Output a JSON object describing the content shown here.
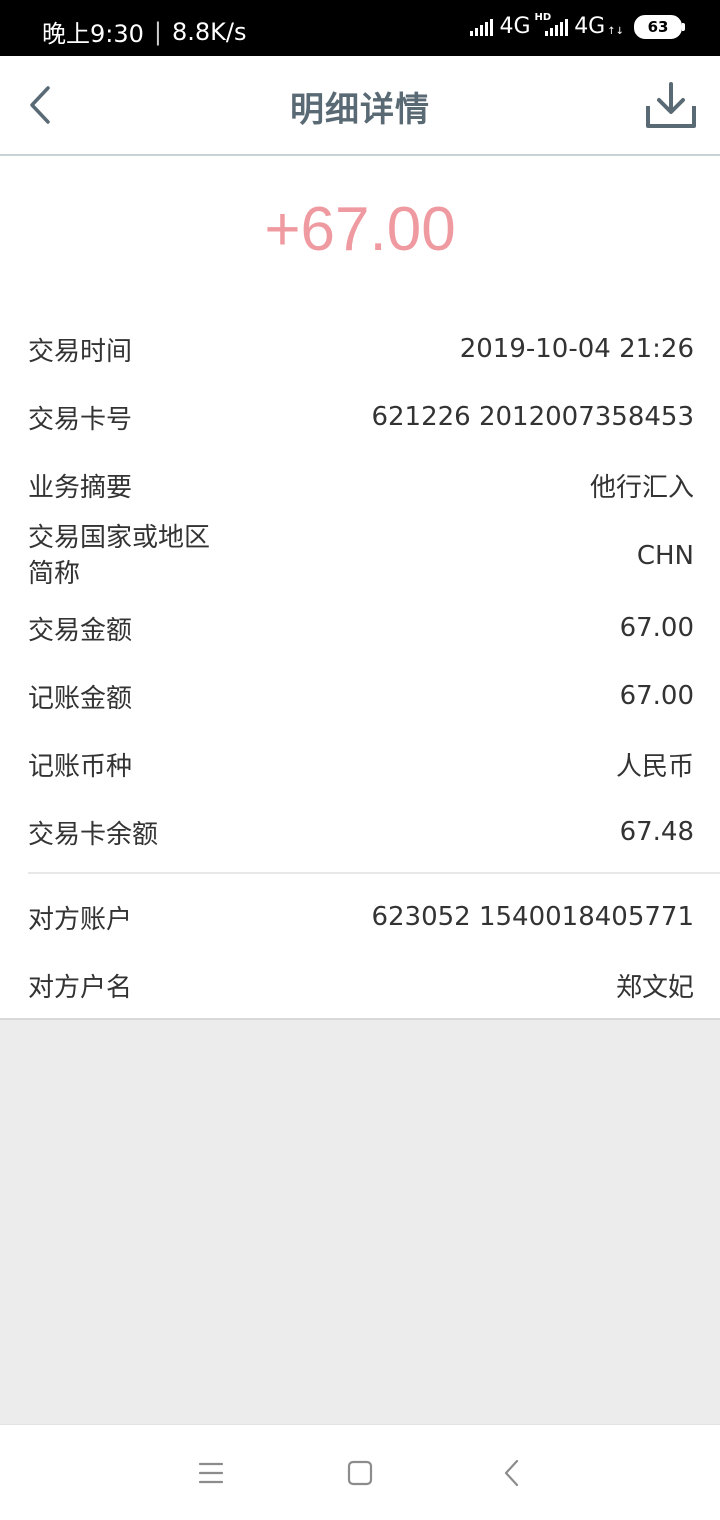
{
  "status_bar": {
    "time": "晚上9:30",
    "net_speed": "8.8K/s",
    "network_1": "4G",
    "hd_badge": "HD",
    "network_2": "4G",
    "battery": "63"
  },
  "header": {
    "title": "明细详情",
    "back_icon": "chevron-left-icon",
    "download_icon": "download-icon"
  },
  "amount": {
    "value": "+67.00",
    "color": "#ef9aa0"
  },
  "details": [
    {
      "label": "交易时间",
      "value": "2019-10-04 21:26"
    },
    {
      "label": "交易卡号",
      "value": "621226 2012007358453"
    },
    {
      "label": "业务摘要",
      "value": "他行汇入"
    },
    {
      "label_line1": "交易国家或地区",
      "label_line2": "简称",
      "value": "CHN"
    },
    {
      "label": "交易金额",
      "value": "67.00"
    },
    {
      "label": "记账金额",
      "value": "67.00"
    },
    {
      "label": "记账币种",
      "value": "人民币"
    },
    {
      "label": "交易卡余额",
      "value": "67.48"
    }
  ],
  "counterparty": [
    {
      "label": "对方账户",
      "value": "623052 1540018405771"
    },
    {
      "label": "对方户名",
      "value": "郑文妃"
    }
  ],
  "navbar": {
    "menu_icon": "menu-icon",
    "home_icon": "home-square-icon",
    "back_icon": "back-triangle-icon"
  }
}
